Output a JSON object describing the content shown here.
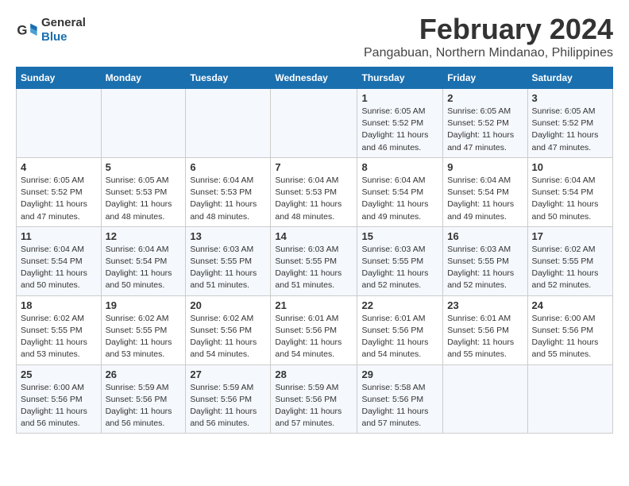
{
  "logo": {
    "text_general": "General",
    "text_blue": "Blue"
  },
  "header": {
    "title": "February 2024",
    "subtitle": "Pangabuan, Northern Mindanao, Philippines"
  },
  "weekdays": [
    "Sunday",
    "Monday",
    "Tuesday",
    "Wednesday",
    "Thursday",
    "Friday",
    "Saturday"
  ],
  "weeks": [
    [
      {
        "day": "",
        "info": ""
      },
      {
        "day": "",
        "info": ""
      },
      {
        "day": "",
        "info": ""
      },
      {
        "day": "",
        "info": ""
      },
      {
        "day": "1",
        "info": "Sunrise: 6:05 AM\nSunset: 5:52 PM\nDaylight: 11 hours and 46 minutes."
      },
      {
        "day": "2",
        "info": "Sunrise: 6:05 AM\nSunset: 5:52 PM\nDaylight: 11 hours and 47 minutes."
      },
      {
        "day": "3",
        "info": "Sunrise: 6:05 AM\nSunset: 5:52 PM\nDaylight: 11 hours and 47 minutes."
      }
    ],
    [
      {
        "day": "4",
        "info": "Sunrise: 6:05 AM\nSunset: 5:52 PM\nDaylight: 11 hours and 47 minutes."
      },
      {
        "day": "5",
        "info": "Sunrise: 6:05 AM\nSunset: 5:53 PM\nDaylight: 11 hours and 48 minutes."
      },
      {
        "day": "6",
        "info": "Sunrise: 6:04 AM\nSunset: 5:53 PM\nDaylight: 11 hours and 48 minutes."
      },
      {
        "day": "7",
        "info": "Sunrise: 6:04 AM\nSunset: 5:53 PM\nDaylight: 11 hours and 48 minutes."
      },
      {
        "day": "8",
        "info": "Sunrise: 6:04 AM\nSunset: 5:54 PM\nDaylight: 11 hours and 49 minutes."
      },
      {
        "day": "9",
        "info": "Sunrise: 6:04 AM\nSunset: 5:54 PM\nDaylight: 11 hours and 49 minutes."
      },
      {
        "day": "10",
        "info": "Sunrise: 6:04 AM\nSunset: 5:54 PM\nDaylight: 11 hours and 50 minutes."
      }
    ],
    [
      {
        "day": "11",
        "info": "Sunrise: 6:04 AM\nSunset: 5:54 PM\nDaylight: 11 hours and 50 minutes."
      },
      {
        "day": "12",
        "info": "Sunrise: 6:04 AM\nSunset: 5:54 PM\nDaylight: 11 hours and 50 minutes."
      },
      {
        "day": "13",
        "info": "Sunrise: 6:03 AM\nSunset: 5:55 PM\nDaylight: 11 hours and 51 minutes."
      },
      {
        "day": "14",
        "info": "Sunrise: 6:03 AM\nSunset: 5:55 PM\nDaylight: 11 hours and 51 minutes."
      },
      {
        "day": "15",
        "info": "Sunrise: 6:03 AM\nSunset: 5:55 PM\nDaylight: 11 hours and 52 minutes."
      },
      {
        "day": "16",
        "info": "Sunrise: 6:03 AM\nSunset: 5:55 PM\nDaylight: 11 hours and 52 minutes."
      },
      {
        "day": "17",
        "info": "Sunrise: 6:02 AM\nSunset: 5:55 PM\nDaylight: 11 hours and 52 minutes."
      }
    ],
    [
      {
        "day": "18",
        "info": "Sunrise: 6:02 AM\nSunset: 5:55 PM\nDaylight: 11 hours and 53 minutes."
      },
      {
        "day": "19",
        "info": "Sunrise: 6:02 AM\nSunset: 5:55 PM\nDaylight: 11 hours and 53 minutes."
      },
      {
        "day": "20",
        "info": "Sunrise: 6:02 AM\nSunset: 5:56 PM\nDaylight: 11 hours and 54 minutes."
      },
      {
        "day": "21",
        "info": "Sunrise: 6:01 AM\nSunset: 5:56 PM\nDaylight: 11 hours and 54 minutes."
      },
      {
        "day": "22",
        "info": "Sunrise: 6:01 AM\nSunset: 5:56 PM\nDaylight: 11 hours and 54 minutes."
      },
      {
        "day": "23",
        "info": "Sunrise: 6:01 AM\nSunset: 5:56 PM\nDaylight: 11 hours and 55 minutes."
      },
      {
        "day": "24",
        "info": "Sunrise: 6:00 AM\nSunset: 5:56 PM\nDaylight: 11 hours and 55 minutes."
      }
    ],
    [
      {
        "day": "25",
        "info": "Sunrise: 6:00 AM\nSunset: 5:56 PM\nDaylight: 11 hours and 56 minutes."
      },
      {
        "day": "26",
        "info": "Sunrise: 5:59 AM\nSunset: 5:56 PM\nDaylight: 11 hours and 56 minutes."
      },
      {
        "day": "27",
        "info": "Sunrise: 5:59 AM\nSunset: 5:56 PM\nDaylight: 11 hours and 56 minutes."
      },
      {
        "day": "28",
        "info": "Sunrise: 5:59 AM\nSunset: 5:56 PM\nDaylight: 11 hours and 57 minutes."
      },
      {
        "day": "29",
        "info": "Sunrise: 5:58 AM\nSunset: 5:56 PM\nDaylight: 11 hours and 57 minutes."
      },
      {
        "day": "",
        "info": ""
      },
      {
        "day": "",
        "info": ""
      }
    ]
  ]
}
